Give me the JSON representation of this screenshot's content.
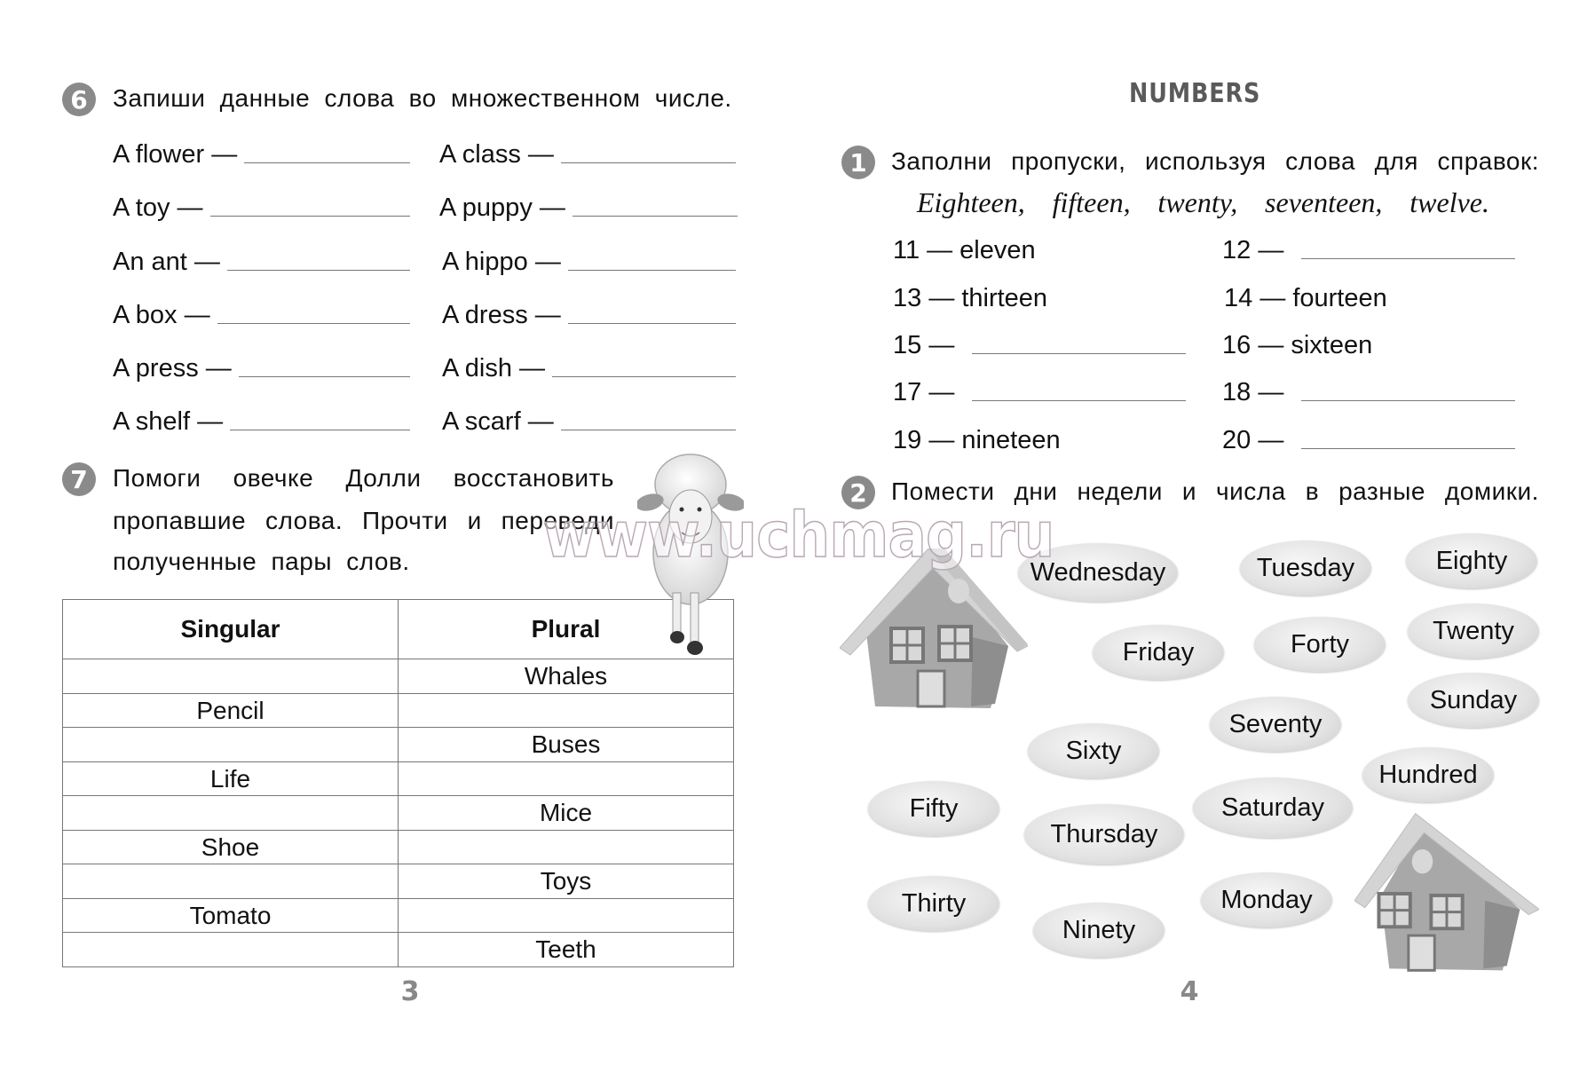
{
  "left_page": {
    "page_number": "3",
    "exercise6": {
      "number": "6",
      "instruction": "Запиши данные слова во множественном числе.",
      "left_column": [
        "A  flower —",
        "A  toy —",
        "An  ant —",
        "A  box —",
        "A  press —",
        "A  shelf —"
      ],
      "right_column": [
        "A  class —",
        "A  puppy —",
        "A  hippo —",
        "A  dress —",
        "A  dish —",
        "A  scarf —"
      ]
    },
    "exercise7": {
      "number": "7",
      "instruction_lines": [
        [
          "Помоги",
          "овечке",
          "Долли",
          "восстановить"
        ],
        [
          "пропавшие",
          "слова.",
          "Прочти",
          "и",
          "переведи"
        ],
        [
          "полученные пары слов."
        ]
      ],
      "table": {
        "headers": [
          "Singular",
          "Plural"
        ],
        "rows": [
          [
            "",
            "Whales"
          ],
          [
            "Pencil",
            ""
          ],
          [
            "",
            "Buses"
          ],
          [
            "Life",
            ""
          ],
          [
            "",
            "Mice"
          ],
          [
            "Shoe",
            ""
          ],
          [
            "",
            "Toys"
          ],
          [
            "Tomato",
            ""
          ],
          [
            "",
            "Teeth"
          ]
        ]
      }
    }
  },
  "right_page": {
    "page_number": "4",
    "title": "NUMBERS",
    "exercise1": {
      "number": "1",
      "instruction_words": [
        "Заполни",
        "пропуски,",
        "используя",
        "слова",
        "для",
        "справок:"
      ],
      "reference_words": [
        "Eighteen,",
        "fifteen,",
        "twenty,",
        "seventeen,",
        "twelve."
      ],
      "items": [
        {
          "num": "11 —",
          "word": "eleven"
        },
        {
          "num": "12 —",
          "word": ""
        },
        {
          "num": "13 —",
          "word": "thirteen"
        },
        {
          "num": "14 —",
          "word": "fourteen"
        },
        {
          "num": "15 —",
          "word": ""
        },
        {
          "num": "16 —",
          "word": "sixteen"
        },
        {
          "num": "17 —",
          "word": ""
        },
        {
          "num": "18 —",
          "word": ""
        },
        {
          "num": "19 —",
          "word": "nineteen"
        },
        {
          "num": "20 —",
          "word": ""
        }
      ]
    },
    "exercise2": {
      "number": "2",
      "instruction_words": [
        "Помести",
        "дни",
        "недели",
        "и",
        "числа",
        "в",
        "разные",
        "домики."
      ],
      "bubbles": [
        "Wednesday",
        "Tuesday",
        "Eighty",
        "Friday",
        "Forty",
        "Twenty",
        "Sunday",
        "Seventy",
        "Sixty",
        "Hundred",
        "Fifty",
        "Saturday",
        "Thursday",
        "Thirty",
        "Monday",
        "Ninety"
      ]
    }
  },
  "watermark": "www.uchmag.ru",
  "colors": {
    "badge": "#8a8a8a",
    "title": "#5a5a5a",
    "rule": "#777777",
    "watermark_stroke": "#b9a7b4"
  }
}
